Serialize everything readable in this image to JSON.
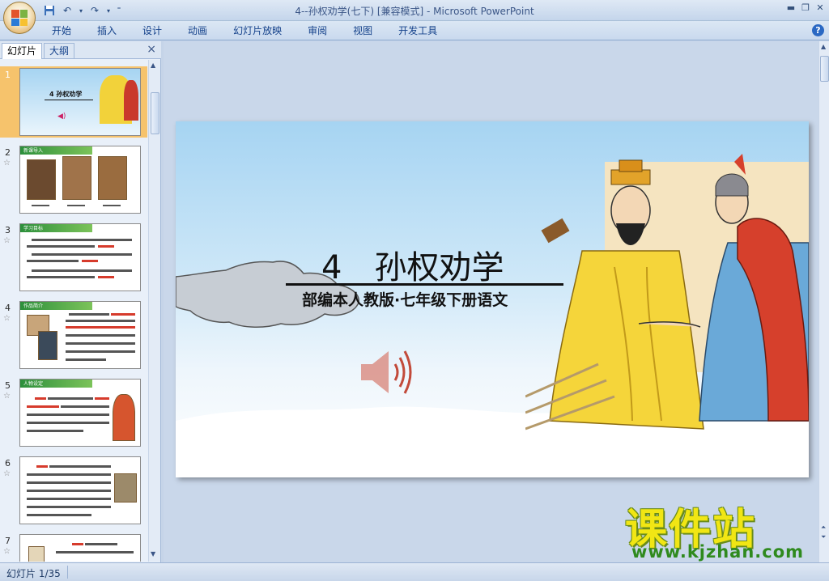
{
  "window": {
    "title": "4--孙权劝学(七下) [兼容模式]",
    "separator": " - ",
    "app_name": "Microsoft PowerPoint"
  },
  "ribbon": {
    "tabs": [
      "开始",
      "插入",
      "设计",
      "动画",
      "幻灯片放映",
      "审阅",
      "视图",
      "开发工具"
    ],
    "help": "?"
  },
  "left_panel": {
    "tabs": [
      "幻灯片",
      "大纲"
    ],
    "active_tab": "幻灯片",
    "close": "×",
    "thumbnails": [
      {
        "number": "1",
        "label": "4 孙权劝学"
      },
      {
        "number": "2",
        "label": "新课导入"
      },
      {
        "number": "3",
        "label": "学习目标"
      },
      {
        "number": "4",
        "label": "作品简介"
      },
      {
        "number": "5",
        "label": "人物设定"
      },
      {
        "number": "6",
        "label": ""
      },
      {
        "number": "7",
        "label": ""
      }
    ]
  },
  "slide": {
    "title": "4　孙权劝学",
    "subtitle": "部编本人教版·七年级下册语文"
  },
  "watermark": {
    "text": "课件站",
    "url": "www.kjzhan.com"
  },
  "status": {
    "slide_info": "幻灯片 1/35"
  },
  "colors": {
    "ribbon_text": "#15428b",
    "active_thumb": "#f6c36c",
    "watermark_yellow": "#f1e614",
    "watermark_green": "#2f8a1e"
  }
}
